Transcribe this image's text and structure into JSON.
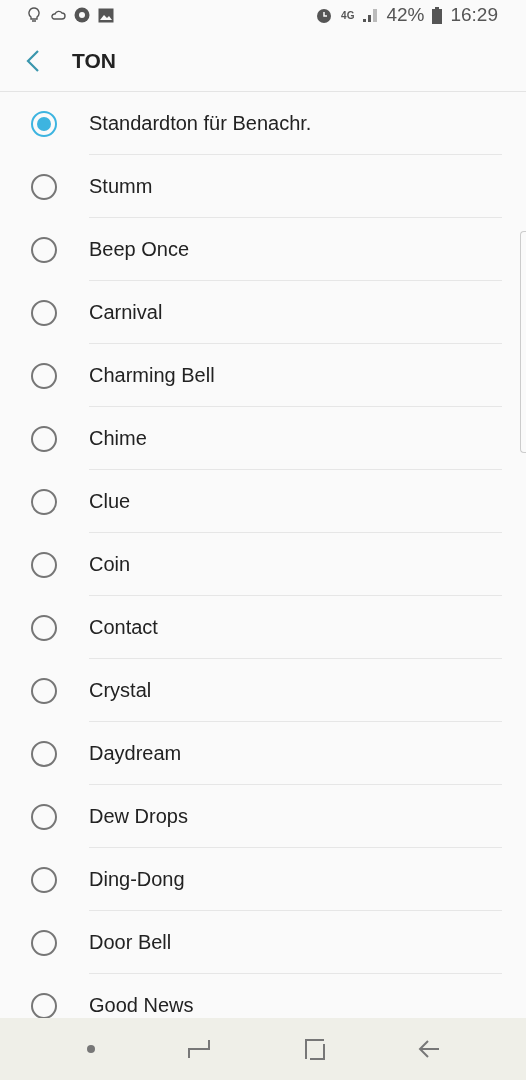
{
  "status_bar": {
    "battery": "42%",
    "time": "16:29",
    "network": "4G"
  },
  "header": {
    "title": "TON"
  },
  "options": [
    {
      "label": "Standardton für Benachr.",
      "selected": true
    },
    {
      "label": "Stumm",
      "selected": false
    },
    {
      "label": "Beep Once",
      "selected": false
    },
    {
      "label": "Carnival",
      "selected": false
    },
    {
      "label": "Charming Bell",
      "selected": false
    },
    {
      "label": "Chime",
      "selected": false
    },
    {
      "label": "Clue",
      "selected": false
    },
    {
      "label": "Coin",
      "selected": false
    },
    {
      "label": "Contact",
      "selected": false
    },
    {
      "label": "Crystal",
      "selected": false
    },
    {
      "label": "Daydream",
      "selected": false
    },
    {
      "label": "Dew Drops",
      "selected": false
    },
    {
      "label": "Ding-Dong",
      "selected": false
    },
    {
      "label": "Door Bell",
      "selected": false
    },
    {
      "label": "Good News",
      "selected": false
    }
  ]
}
